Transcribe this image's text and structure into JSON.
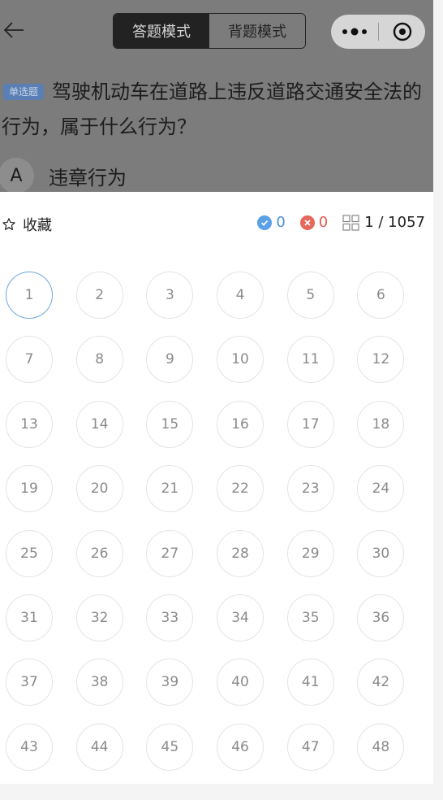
{
  "header": {
    "back_icon": "arrow-left-icon",
    "mode_tabs": [
      {
        "label": "答题模式",
        "active": true
      },
      {
        "label": "背题模式",
        "active": false
      }
    ],
    "capsule": {
      "more_icon": "more-dots-icon",
      "close_icon": "target-circle-icon"
    }
  },
  "question": {
    "type_badge": "单选题",
    "text": "驾驶机动车在道路上违反道路交通安全法的行为，属于什么行为？",
    "option": {
      "letter": "A",
      "text": "违章行为"
    }
  },
  "sheet": {
    "favorite_label": "收藏",
    "correct_count": "0",
    "wrong_count": "0",
    "progress": "1 / 1057",
    "current_number": 1,
    "numbers": [
      "1",
      "2",
      "3",
      "4",
      "5",
      "6",
      "7",
      "8",
      "9",
      "10",
      "11",
      "12",
      "13",
      "14",
      "15",
      "16",
      "17",
      "18",
      "19",
      "20",
      "21",
      "22",
      "23",
      "24",
      "25",
      "26",
      "27",
      "28",
      "29",
      "30",
      "31",
      "32",
      "33",
      "34",
      "35",
      "36",
      "37",
      "38",
      "39",
      "40",
      "41",
      "42",
      "43",
      "44",
      "45",
      "46",
      "47",
      "48"
    ]
  },
  "colors": {
    "overlay": "#7c7c7c",
    "accent_blue": "#5aa0e6",
    "accent_red": "#e6675c"
  }
}
